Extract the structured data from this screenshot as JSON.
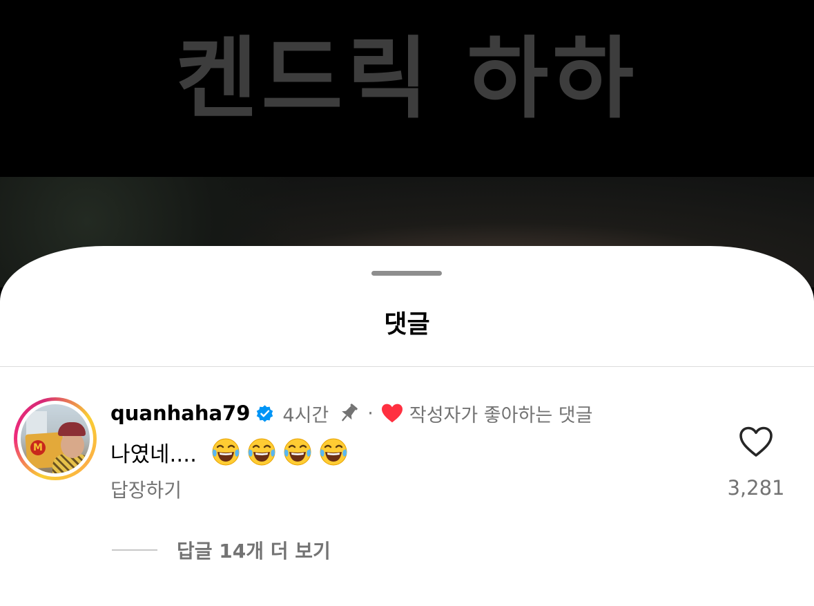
{
  "video": {
    "caption": "켄드릭 하하"
  },
  "sheet": {
    "title": "댓글"
  },
  "comment": {
    "username": "quanhaha79",
    "time": "4시간",
    "separator": "·",
    "liked_by_author": "작성자가 좋아하는 댓글",
    "text": "나였네....",
    "emoji_count": 4,
    "emoji": "face-with-tears-of-joy",
    "reply_label": "답장하기",
    "like_count": "3,281",
    "view_replies_label": "답글 14개 더 보기"
  },
  "colors": {
    "verified": "#0095f6",
    "author_heart": "#ff3040",
    "secondary_text": "#737373"
  }
}
